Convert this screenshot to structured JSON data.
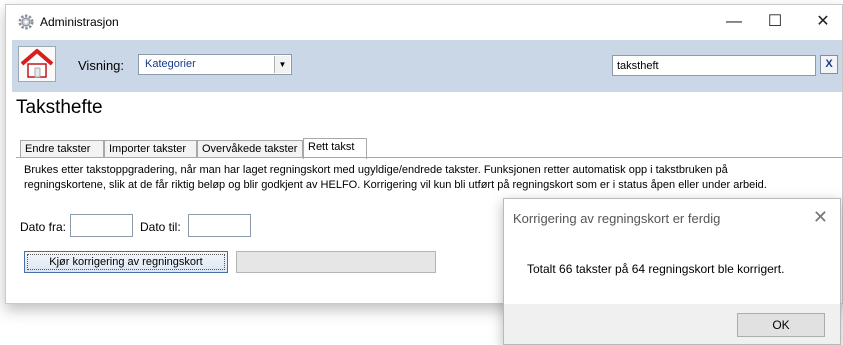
{
  "window": {
    "title": "Administrasjon",
    "minimize": "—",
    "maximize": "☐",
    "close": "✕"
  },
  "toolbar": {
    "view_label": "Visning:",
    "view_value": "Kategorier",
    "search_value": "takstheft",
    "clear_label": "X"
  },
  "page": {
    "title": "Taksthefte",
    "tabs": [
      {
        "label": "Endre takster",
        "active": false
      },
      {
        "label": "Importer takster",
        "active": false
      },
      {
        "label": "Overvåkede takster",
        "active": false
      },
      {
        "label": "Rett takst",
        "active": true
      }
    ],
    "description_line1": "Brukes etter takstoppgradering, når man har laget regningskort med ugyldige/endrede takster. Funksjonen retter automatisk opp i takstbruken på",
    "description_line2": "regningskortene, slik at de får riktig beløp og blir godkjent av HELFO. Korrigering vil kun bli utført på regningskort som er i status åpen eller under arbeid.",
    "date_from_label": "Dato fra:",
    "date_to_label": "Dato til:",
    "run_button_label": "Kjør korrigering av regningskort"
  },
  "dialog": {
    "title": "Korrigering av regningskort er ferdig",
    "close": "✕",
    "message": "Totalt 66 takster på 64 regningskort ble korrigert.",
    "ok_label": "OK"
  },
  "colors": {
    "toolbar_bg": "#c9d7e6",
    "link_blue": "#1a3a8c",
    "home_roof": "#d81e1e"
  },
  "icons": {
    "window_icon": "gear-icon",
    "home_button": "home-icon",
    "dropdown": "chevron-down-icon"
  }
}
